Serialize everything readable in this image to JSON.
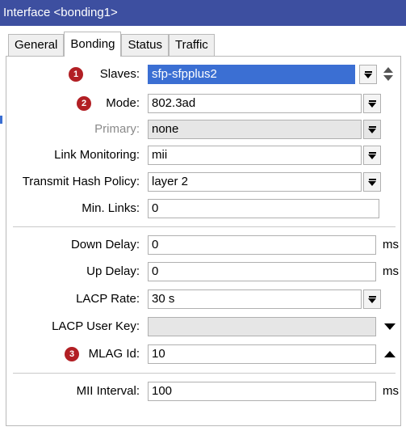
{
  "window": {
    "title": "Interface <bonding1>"
  },
  "tabs": [
    {
      "label": "General"
    },
    {
      "label": "Bonding"
    },
    {
      "label": "Status"
    },
    {
      "label": "Traffic"
    }
  ],
  "badges": [
    "1",
    "2",
    "3"
  ],
  "fields": {
    "slaves": {
      "label": "Slaves:",
      "value": "sfp-sfpplus2"
    },
    "mode": {
      "label": "Mode:",
      "value": "802.3ad"
    },
    "primary": {
      "label": "Primary:",
      "value": "none"
    },
    "link_monitoring": {
      "label": "Link Monitoring:",
      "value": "mii"
    },
    "transmit_hash_policy": {
      "label": "Transmit Hash Policy:",
      "value": "layer 2"
    },
    "min_links": {
      "label": "Min. Links:",
      "value": "0"
    },
    "down_delay": {
      "label": "Down Delay:",
      "value": "0",
      "unit": "ms"
    },
    "up_delay": {
      "label": "Up Delay:",
      "value": "0",
      "unit": "ms"
    },
    "lacp_rate": {
      "label": "LACP Rate:",
      "value": "30 s"
    },
    "lacp_user_key": {
      "label": "LACP User Key:",
      "value": ""
    },
    "mlag_id": {
      "label": "MLAG Id:",
      "value": "10"
    },
    "mii_interval": {
      "label": "MII Interval:",
      "value": "100",
      "unit": "ms"
    }
  },
  "colors": {
    "titlebar": "#3d4fa0",
    "selection": "#3b6fd3",
    "badge": "#b21f24"
  }
}
